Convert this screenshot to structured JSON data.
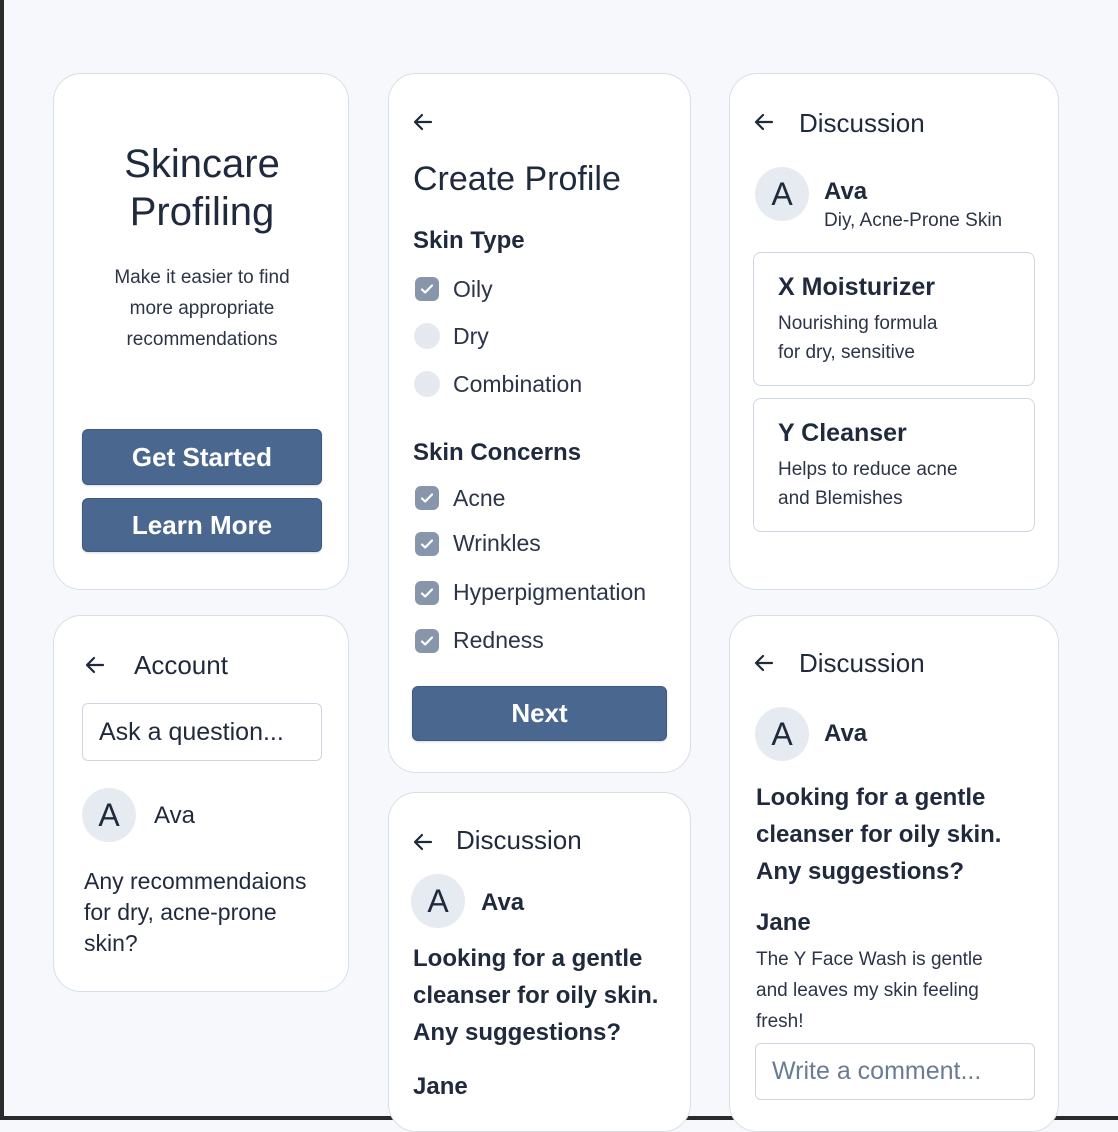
{
  "welcome": {
    "title_line1": "Skincare",
    "title_line2": "Profiling",
    "subtitle_line1": "Make it easier to find",
    "subtitle_line2": "more appropriate",
    "subtitle_line3": "recommendations",
    "get_started": "Get Started",
    "learn_more": "Learn More"
  },
  "profile": {
    "title": "Create Profile",
    "skin_type_heading": "Skin Type",
    "skin_types": [
      {
        "label": "Oily",
        "checked": true
      },
      {
        "label": "Dry",
        "checked": false
      },
      {
        "label": "Combination",
        "checked": false
      }
    ],
    "concerns_heading": "Skin Concerns",
    "concerns": [
      {
        "label": "Acne",
        "checked": true
      },
      {
        "label": "Wrinkles",
        "checked": true
      },
      {
        "label": "Hyperpigmentation",
        "checked": true
      },
      {
        "label": "Redness",
        "checked": true
      }
    ],
    "next": "Next"
  },
  "recommendations": {
    "title": "Discussion",
    "avatar_initial": "A",
    "user_name": "Ava",
    "user_skin": "Diy, Acne-Prone Skin",
    "products": [
      {
        "name": "X Moisturizer",
        "desc_line1": "Nourishing formula",
        "desc_line2": "for dry, sensitive"
      },
      {
        "name": "Y Cleanser",
        "desc_line1": "Helps to reduce acne",
        "desc_line2": "and Blemishes"
      }
    ]
  },
  "account": {
    "title": "Account",
    "search_placeholder": "Ask a question...",
    "avatar_initial": "A",
    "user_name": "Ava",
    "question_line1": "Any recommendaions",
    "question_line2": "for dry, acne-prone",
    "question_line3": "skin?"
  },
  "discussion_mid": {
    "title": "Discussion",
    "avatar_initial": "A",
    "user_name": "Ava",
    "post_line1": "Looking for a gentle",
    "post_line2": "cleanser for oily skin.",
    "post_line3": "Any suggestions?",
    "reply_name": "Jane"
  },
  "discussion_right": {
    "title": "Discussion",
    "avatar_initial": "A",
    "user_name": "Ava",
    "post_line1": "Looking for a gentle",
    "post_line2": "cleanser for oily skin.",
    "post_line3": "Any suggestions?",
    "reply_name": "Jane",
    "reply_line1": "The Y Face Wash is gentle",
    "reply_line2": "and leaves my skin feeling",
    "reply_line3": "fresh!",
    "comment_placeholder": "Write a comment..."
  },
  "colors": {
    "primary": "#4a6790",
    "background": "#f6f8fb",
    "card_border": "#d6dfea",
    "checkbox": "#8796ab"
  },
  "icons": [
    "back-arrow-icon",
    "checkmark-icon"
  ]
}
